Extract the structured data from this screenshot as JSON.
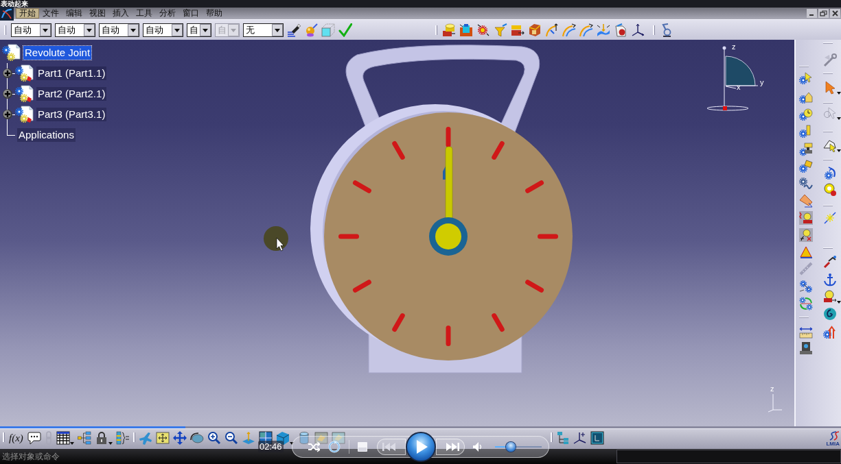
{
  "window": {
    "title": "表动起来"
  },
  "menu": [
    {
      "label": "开始",
      "selected": true
    },
    {
      "label": "文件",
      "selected": false
    },
    {
      "label": "编辑",
      "selected": false
    },
    {
      "label": "视图",
      "selected": false
    },
    {
      "label": "插入",
      "selected": false
    },
    {
      "label": "工具",
      "selected": false
    },
    {
      "label": "分析",
      "selected": false
    },
    {
      "label": "窗口",
      "selected": false
    },
    {
      "label": "帮助",
      "selected": false
    }
  ],
  "toolbar": {
    "dropdowns": [
      {
        "value": "自动",
        "disabled": false
      },
      {
        "value": "自动",
        "disabled": false
      },
      {
        "value": "自动",
        "disabled": false
      },
      {
        "value": "自动",
        "disabled": false
      },
      {
        "value": "自",
        "disabled": false
      },
      {
        "value": "自",
        "disabled": true
      },
      {
        "value": "无",
        "disabled": false
      }
    ]
  },
  "tree": {
    "items": [
      {
        "label": "Revolute Joint",
        "kind": "product",
        "selected": true,
        "children": [
          {
            "label": "Part1 (Part1.1)",
            "kind": "part",
            "expanded": false,
            "selected": false
          },
          {
            "label": "Part2 (Part2.1)",
            "kind": "part",
            "expanded": false,
            "selected": false
          },
          {
            "label": "Part3 (Part3.1)",
            "kind": "part",
            "expanded": false,
            "selected": false
          },
          {
            "label": "Applications",
            "kind": "branch",
            "selected": false
          }
        ]
      }
    ]
  },
  "compass": {
    "labels": [
      "z",
      "y",
      "x"
    ]
  },
  "view_axis": {
    "label": "z"
  },
  "bottom_toolbar": {
    "formula_label": "f(x)"
  },
  "brand": {
    "text": "LMIA"
  },
  "player": {
    "time": "02:46",
    "playing": false,
    "seek": {
      "level": 0.22
    },
    "volume": {
      "level": 0.3
    }
  },
  "status_bar": {
    "prompt": "选择对象或命令"
  }
}
